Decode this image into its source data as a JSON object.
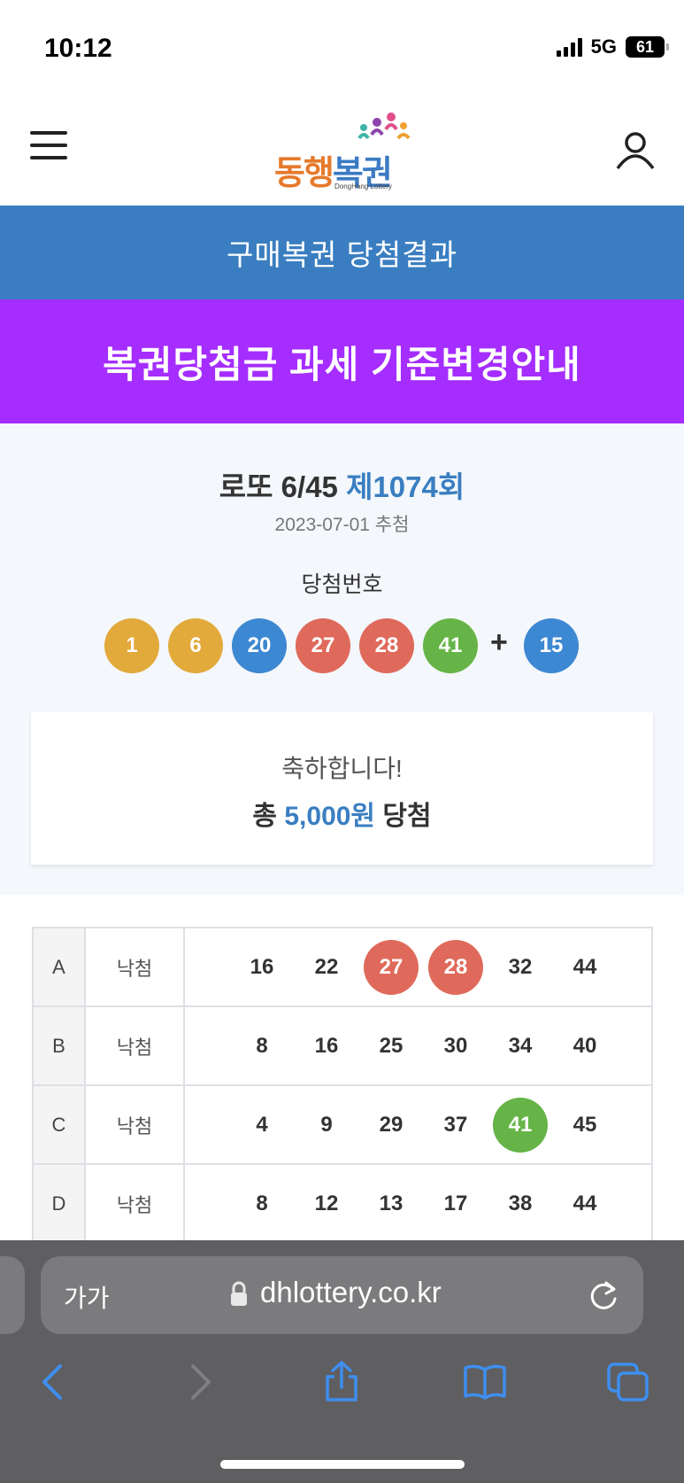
{
  "status_bar": {
    "time": "10:12",
    "network": "5G",
    "battery": "61"
  },
  "header": {
    "logo_main_1": "동행",
    "logo_main_2": "복권",
    "logo_sub": "DongHang Lottery"
  },
  "page_title": "구매복권 당첨결과",
  "notice_banner": "복권당첨금 과세 기준변경안내",
  "draw": {
    "game": "로또 6/45",
    "round": "제1074회",
    "date": "2023-07-01 추첨",
    "winning_label": "당첨번호",
    "winning_numbers": [
      "1",
      "6",
      "20",
      "27",
      "28",
      "41"
    ],
    "plus": "+",
    "bonus_number": "15"
  },
  "prize": {
    "congrats": "축하합니다!",
    "prefix": "총",
    "amount": "5,000원",
    "suffix": "당첨"
  },
  "tickets": [
    {
      "label": "A",
      "status": "낙첨",
      "numbers": [
        "16",
        "22",
        "27",
        "28",
        "32",
        "44"
      ]
    },
    {
      "label": "B",
      "status": "낙첨",
      "numbers": [
        "8",
        "16",
        "25",
        "30",
        "34",
        "40"
      ]
    },
    {
      "label": "C",
      "status": "낙첨",
      "numbers": [
        "4",
        "9",
        "29",
        "37",
        "41",
        "45"
      ]
    },
    {
      "label": "D",
      "status": "낙첨",
      "numbers": [
        "8",
        "12",
        "13",
        "17",
        "38",
        "44"
      ]
    }
  ],
  "browser": {
    "text_size": "가가",
    "url": "dhlottery.co.kr"
  },
  "colors": {
    "ball_yellow": "#e2a93b",
    "ball_blue": "#3d88d2",
    "ball_red": "#df6a5b",
    "ball_green": "#66b447",
    "accent_blue": "#3a7ec1",
    "banner_purple": "#a52dff"
  }
}
